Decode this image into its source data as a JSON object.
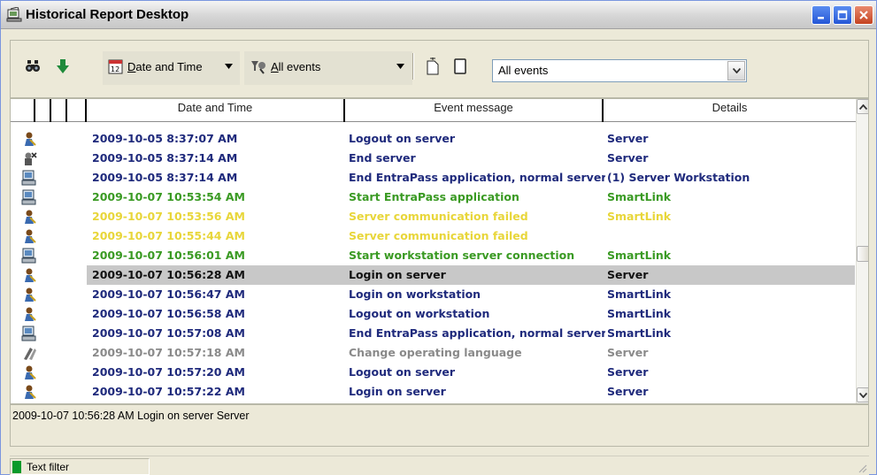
{
  "window": {
    "title": "Historical Report Desktop"
  },
  "toolbar": {
    "sort_field_label": "Date and Time",
    "filter_label": "All events",
    "combo_value": "All events"
  },
  "grid": {
    "columns": [
      "Date and Time",
      "Event message",
      "Details"
    ],
    "rows": [
      {
        "icon": "user-key-icon",
        "date": "2009-10-05 8:37:07 AM",
        "message": "Logout on server",
        "details": "Server",
        "color": "#1f2a7c",
        "selected": false
      },
      {
        "icon": "server-stop-icon",
        "date": "2009-10-05 8:37:14 AM",
        "message": "End server",
        "details": "Server",
        "color": "#1f2a7c",
        "selected": false
      },
      {
        "icon": "workstation-icon",
        "date": "2009-10-05 8:37:14 AM",
        "message": "End EntraPass application, normal server di",
        "details": "(1)  Server Workstation",
        "color": "#1f2a7c",
        "selected": false
      },
      {
        "icon": "workstation-icon",
        "date": "2009-10-07 10:53:54 AM",
        "message": "Start EntraPass application",
        "details": "SmartLink",
        "color": "#3a9a23",
        "selected": false
      },
      {
        "icon": "user-key-icon",
        "date": "2009-10-07 10:53:56 AM",
        "message": "Server communication failed",
        "details": "SmartLink",
        "color": "#e8d63a",
        "selected": false
      },
      {
        "icon": "user-key-icon",
        "date": "2009-10-07 10:55:44 AM",
        "message": "Server communication failed",
        "details": "",
        "color": "#e8d63a",
        "selected": false
      },
      {
        "icon": "workstation-icon",
        "date": "2009-10-07 10:56:01 AM",
        "message": "Start workstation server connection",
        "details": "SmartLink",
        "color": "#3a9a23",
        "selected": false
      },
      {
        "icon": "user-key-icon",
        "date": "2009-10-07 10:56:28 AM",
        "message": "Login on server",
        "details": "Server",
        "color": "#111111",
        "selected": true
      },
      {
        "icon": "user-key-icon",
        "date": "2009-10-07 10:56:47 AM",
        "message": "Login on workstation",
        "details": "SmartLink",
        "color": "#1f2a7c",
        "selected": false
      },
      {
        "icon": "user-key-icon",
        "date": "2009-10-07 10:56:58 AM",
        "message": "Logout on workstation",
        "details": "SmartLink",
        "color": "#1f2a7c",
        "selected": false
      },
      {
        "icon": "workstation-icon",
        "date": "2009-10-07 10:57:08 AM",
        "message": "End EntraPass application, normal server di",
        "details": "SmartLink",
        "color": "#1f2a7c",
        "selected": false
      },
      {
        "icon": "language-icon",
        "date": "2009-10-07 10:57:18 AM",
        "message": "Change operating language",
        "details": "Server",
        "color": "#8a8a8a",
        "selected": false
      },
      {
        "icon": "user-key-icon",
        "date": "2009-10-07 10:57:20 AM",
        "message": "Logout on server",
        "details": "Server",
        "color": "#1f2a7c",
        "selected": false
      },
      {
        "icon": "user-key-icon",
        "date": "2009-10-07 10:57:22 AM",
        "message": "Login on server",
        "details": "Server",
        "color": "#1f2a7c",
        "selected": false
      }
    ]
  },
  "detail_pane": {
    "text": "2009-10-07 10:56:28 AM  Login on server  Server"
  },
  "statusbar": {
    "filter_text": "Text filter"
  }
}
